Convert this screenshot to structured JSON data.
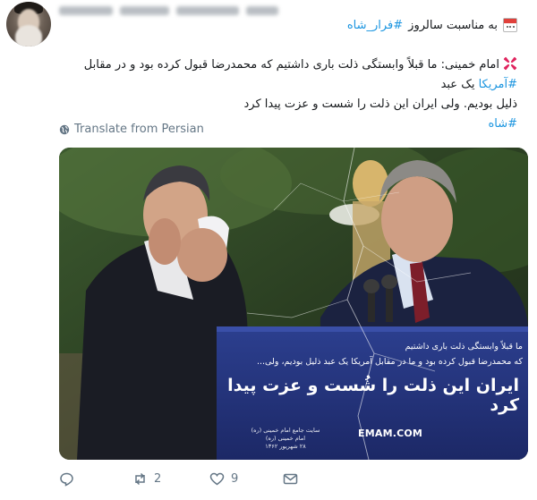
{
  "header": {
    "line1_text": "به مناسبت سالروز",
    "line1_hashtag": "#فرار_شاه",
    "calendar_icon": "calendar-icon"
  },
  "body": {
    "line1_a": "امام خمینی: ما قبلاً وابستگی ذلت باری داشتیم که محمدرضا قبول کرده بود و در مقابل",
    "line1_hashtag": "#آمریکا",
    "line1_b": "یک عبد",
    "line2": "ذلیل بودیم. ولی ایران این ذلت را شست و عزت پیدا کرد",
    "line3_hashtag": "#شاه",
    "anger_icon": "anger-symbol-icon"
  },
  "translate": {
    "label": "Translate from Persian",
    "icon": "globe-icon"
  },
  "image": {
    "caption_line1": "ما قبلاً وابستگی ذلت باری داشتیم",
    "caption_line2": "که محمدرضا قبول کرده بود و ما در مقابل آمریکا یک عبد ذلیل بودیم، ولی...",
    "caption_big": "ایران این ذلت را شُست و عزت پیدا کرد",
    "brand": "EMAM.COM",
    "brand_sub_line1": "سایت جامع امام خمینی (ره)",
    "brand_sub_line2": "امام خمینی (ره)",
    "brand_sub_line3": "۲۸ شهریور ۱۳۶۲"
  },
  "actions": {
    "reply_icon": "reply-icon",
    "retweet_icon": "retweet-icon",
    "retweet_count": "2",
    "like_icon": "heart-icon",
    "like_count": "9",
    "dm_icon": "envelope-icon"
  },
  "colors": {
    "hashtag": "#1b95e0",
    "muted": "#657786",
    "podium": "#23327a"
  }
}
